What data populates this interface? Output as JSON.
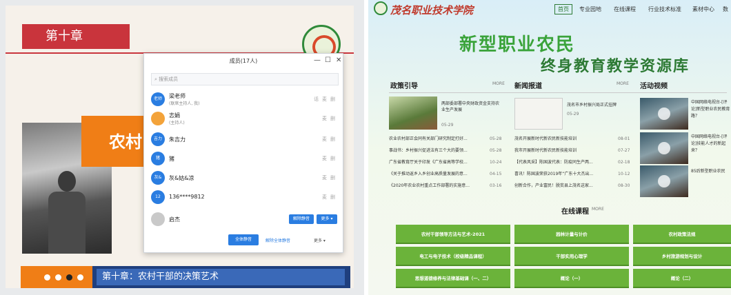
{
  "left": {
    "chapter": "第十章",
    "orange_text": "农村",
    "bottom_title": "第十章：农村干部的决策艺术",
    "dialog": {
      "title": "成员(17人)",
      "minimize": "—",
      "maximize": "☐",
      "close": "✕",
      "search_placeholder": "搜索成员",
      "members": [
        {
          "avatar": "老师",
          "name": "梁老师",
          "role": "(联席主持人, 我)",
          "icons": [
            "话",
            "麦",
            "删"
          ]
        },
        {
          "avatar": "",
          "name": "志娟",
          "role": "(主持人)",
          "icons": [
            "麦",
            "删"
          ]
        },
        {
          "avatar": "吉力",
          "name": "朱吉力",
          "role": "",
          "icons": [
            "麦",
            "删"
          ]
        },
        {
          "avatar": "猪",
          "name": "猪",
          "role": "",
          "icons": [
            "麦",
            "删"
          ]
        },
        {
          "avatar": "灰&",
          "name": "灰&姑&凉",
          "role": "",
          "icons": [
            "麦",
            "删"
          ]
        },
        {
          "avatar": "12",
          "name": "136****9812",
          "role": "",
          "icons": [
            "麦",
            "删"
          ]
        },
        {
          "avatar": "",
          "name": "启杰",
          "role": "",
          "icons": []
        }
      ],
      "row_btn1": "解除静音",
      "row_btn2": "更多 ▾",
      "footer_btn1": "全体静音",
      "footer_btn2": "解除全体静音",
      "footer_btn3": "更多 ▾"
    }
  },
  "right": {
    "brand": "茂名职业技术学院",
    "nav": [
      "首页",
      "专业园地",
      "在线课程",
      "行业技术标准",
      "素材中心",
      "数"
    ],
    "headline1": "新型职业农民",
    "headline2": "终身教育教学资源库",
    "sections": {
      "policy": {
        "title": "政策引导",
        "more": "MORE",
        "feature": {
          "text": "两部委部署中央财政资金支持农业生产发展",
          "date": "05-29"
        },
        "items": [
          {
            "t": "农业农村部正会同有关部门研究制定打好...",
            "d": "05-28"
          },
          {
            "t": "事战书：乡村振兴促进法有三个大的要领...",
            "d": "05-28"
          },
          {
            "t": "广东省教育厅关于印发《广东省高等学校...",
            "d": "10-24"
          },
          {
            "t": "《关于推动返乡入乡创业高质量发展的意...",
            "d": "04-15"
          },
          {
            "t": "《2020年农业农村重点工作部署的实施意...",
            "d": "03-16"
          }
        ]
      },
      "news": {
        "title": "新闻报道",
        "more": "MORE",
        "feature": {
          "text": "茂名市乡村振兴局正式挂牌",
          "date": "05-29"
        },
        "items": [
          {
            "t": "茂名开展新时代新农民新技能培训",
            "d": "08-01"
          },
          {
            "t": "我市开展新时代新农民新技能培训",
            "d": "07-27"
          },
          {
            "t": "【代表风采】陈国波代表：防疫同生产两...",
            "d": "02-18"
          },
          {
            "t": "喜讯！陈国波荣获2019年“广东十大杰出...",
            "d": "10-12"
          },
          {
            "t": "创新合作，产业富民！脱贫县上茂名这家...",
            "d": "08-30"
          }
        ]
      },
      "video": {
        "title": "活动视频",
        "items": [
          "中国网络电视台-[评论]新型职业农民教育路？",
          "中国网络电视台-[评论]技能人才的新起来？",
          "85后新型职业农民"
        ]
      }
    },
    "courses": {
      "title": "在线课程",
      "more": "MORE",
      "items": [
        "农村干部领导方法与艺术-2021",
        "园林计量与计价",
        "农村政策法规",
        "电工与电子技术（校级精品课程）",
        "干部实用心理学",
        "乡村旅游规划与设计",
        "思想道德修养与法律基础课（一、二）",
        "概论（一）",
        "概论（二）"
      ]
    }
  },
  "colors": {
    "chapter_red": "#c9343c",
    "orange": "#f07e16",
    "title_blue": "#3a69b8",
    "course_green": "#6bb33a",
    "brand_red": "#c0392b"
  }
}
